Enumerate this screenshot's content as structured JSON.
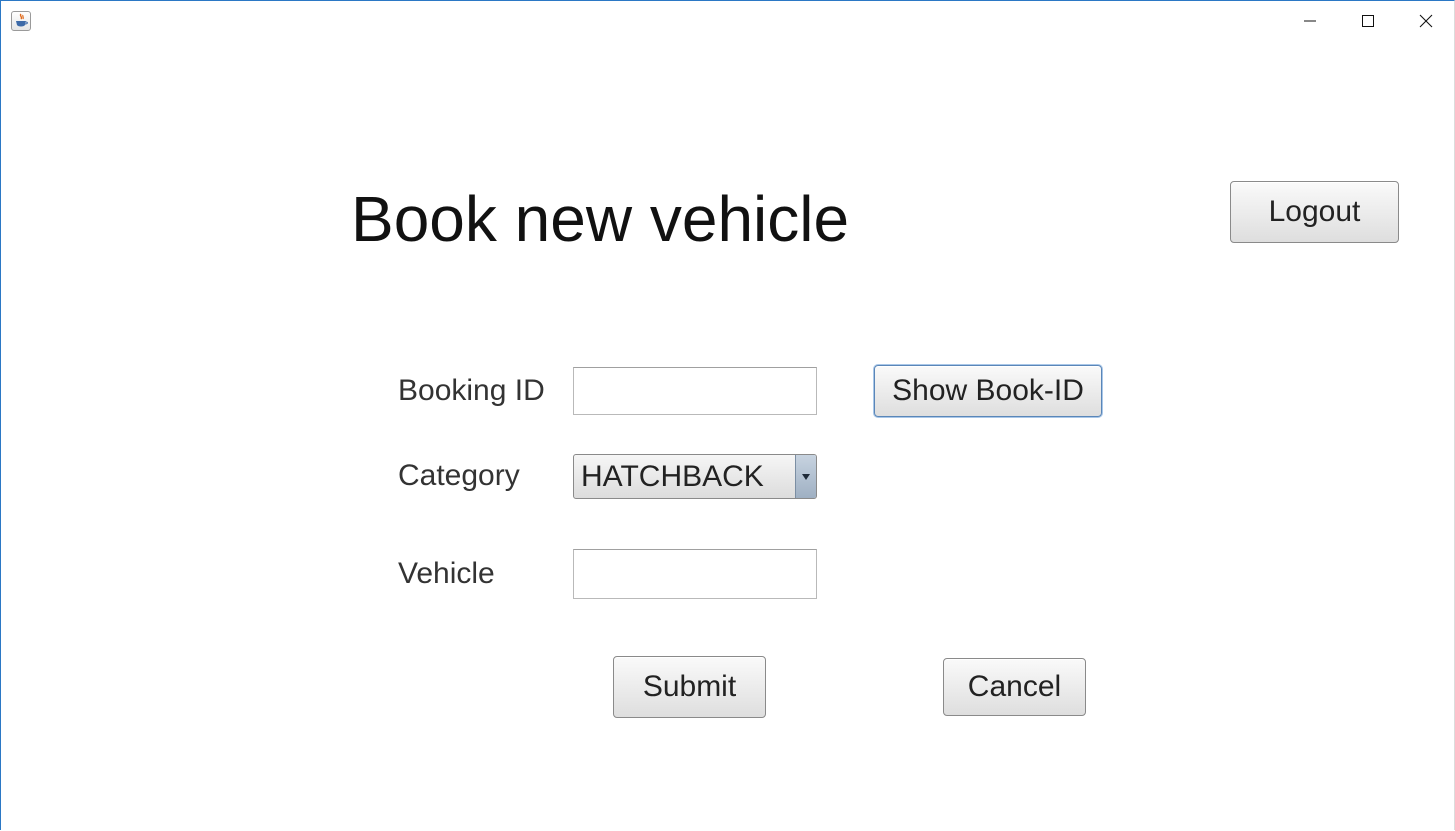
{
  "window": {
    "icon": "java-app-icon",
    "controls": {
      "minimize": "minimize-icon",
      "maximize": "maximize-icon",
      "close": "close-icon"
    }
  },
  "header": {
    "title": "Book new vehicle",
    "logout_label": "Logout"
  },
  "form": {
    "booking_id": {
      "label": "Booking ID",
      "value": "",
      "button_label": "Show Book-ID"
    },
    "category": {
      "label": "Category",
      "selected": "HATCHBACK"
    },
    "vehicle": {
      "label": "Vehicle",
      "value": ""
    }
  },
  "actions": {
    "submit_label": "Submit",
    "cancel_label": "Cancel"
  },
  "colors": {
    "window_border": "#2b78c5",
    "focus_border": "#5a86b8",
    "combo_arrow": "#9fb0c3"
  }
}
